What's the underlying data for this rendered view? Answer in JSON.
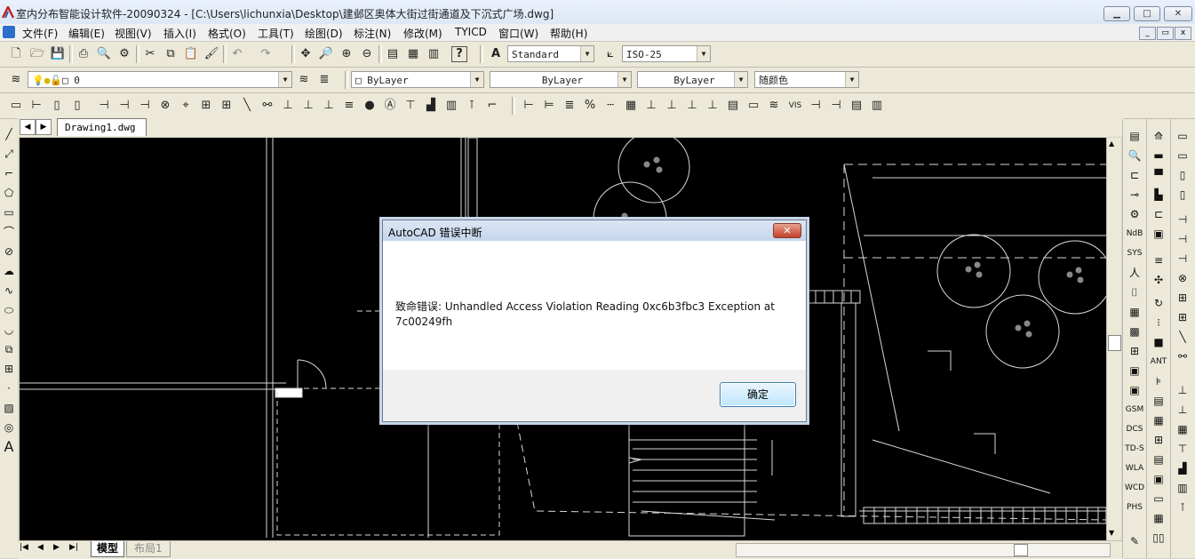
{
  "window": {
    "title": "室内分布智能设计软件-20090324 - [C:\\Users\\lichunxia\\Desktop\\建邺区奥体大街过街通道及下沉式广场.dwg]",
    "minimize": "▁",
    "maximize": "□",
    "close": "✕"
  },
  "menu": {
    "items": [
      "文件(F)",
      "编辑(E)",
      "视图(V)",
      "插入(I)",
      "格式(O)",
      "工具(T)",
      "绘图(D)",
      "标注(N)",
      "修改(M)",
      "TYICD",
      "窗口(W)",
      "帮助(H)"
    ]
  },
  "toolbar": {
    "text_style": "Standard",
    "dim_style": "ISO-25",
    "layer": "0",
    "color": "ByLayer",
    "linetype": "ByLayer",
    "lineweight": "ByLayer",
    "plot_style": "随颜色"
  },
  "tabs": {
    "drawing": "Drawing1.dwg",
    "model": "模型",
    "layout": "布局1"
  },
  "dialog": {
    "title": "AutoCAD 错误中断",
    "message": "致命错误:  Unhandled Access Violation Reading 0xc6b3fbc3 Exception at 7c00249fh",
    "ok_label": "确定",
    "close": "✕"
  },
  "side_labels": {
    "ndb": "NdB",
    "sys": "SYS",
    "gsm": "GSM",
    "dcs": "DCS",
    "tds": "TD-S",
    "wla": "WLA",
    "wcd": "WCD",
    "phs": "PHS",
    "ant": "ANT",
    "vis": "VIS",
    "text_a": "A"
  }
}
